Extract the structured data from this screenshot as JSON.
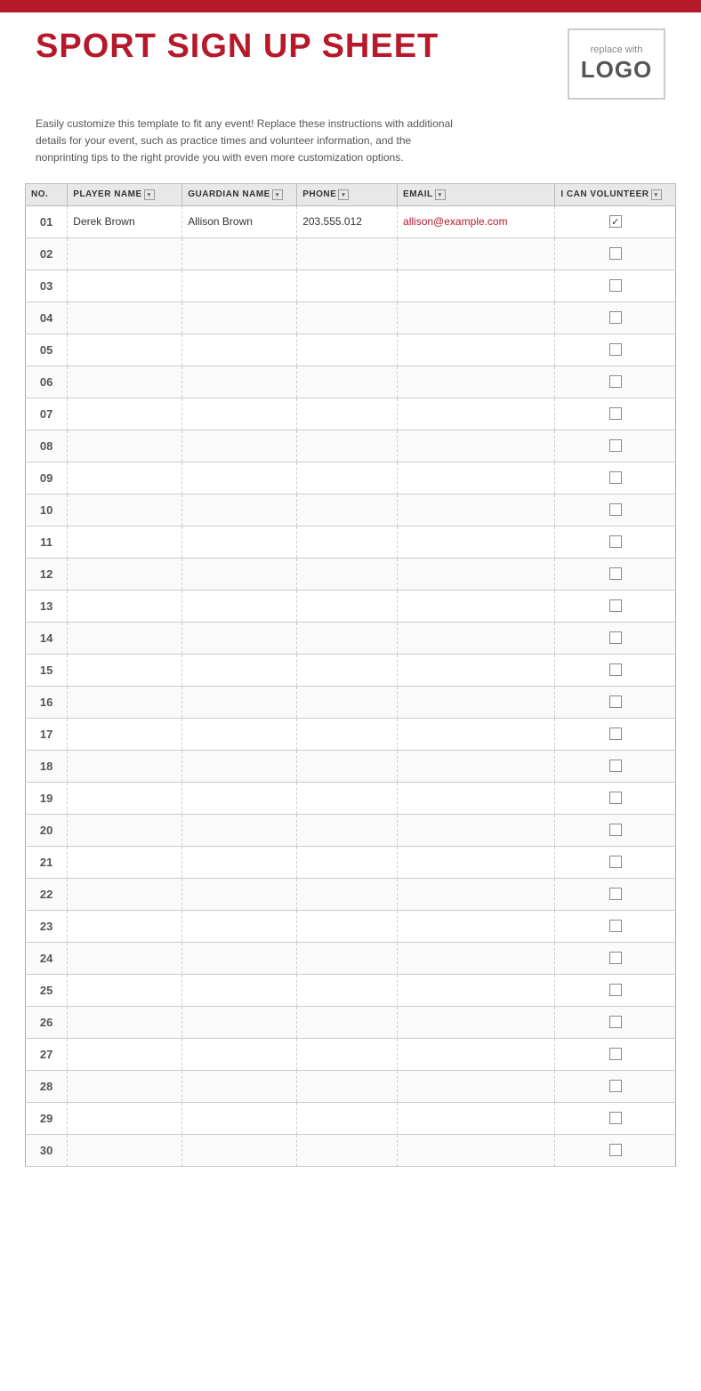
{
  "topBar": {},
  "header": {
    "title": "SPORT SIGN UP SHEET",
    "logo": {
      "replace_text": "replace with",
      "logo_text": "LOGO"
    }
  },
  "description": "Easily customize this template to fit any event! Replace these instructions with additional details for your event, such as practice times and volunteer information, and the nonprinting tips to the right provide you with even more customization options.",
  "table": {
    "columns": [
      {
        "label": "NO.",
        "has_dropdown": false
      },
      {
        "label": "PLAYER NAME",
        "has_dropdown": true
      },
      {
        "label": "GUARDIAN NAME",
        "has_dropdown": true
      },
      {
        "label": "PHONE",
        "has_dropdown": true
      },
      {
        "label": "EMAIL",
        "has_dropdown": true
      },
      {
        "label": "I CAN VOLUNTEER",
        "has_dropdown": true
      }
    ],
    "rows": [
      {
        "num": "01",
        "player": "Derek Brown",
        "guardian": "Allison Brown",
        "phone": "203.555.012",
        "email": "allison@example.com",
        "volunteer": true
      },
      {
        "num": "02",
        "player": "",
        "guardian": "",
        "phone": "",
        "email": "",
        "volunteer": false
      },
      {
        "num": "03",
        "player": "",
        "guardian": "",
        "phone": "",
        "email": "",
        "volunteer": false
      },
      {
        "num": "04",
        "player": "",
        "guardian": "",
        "phone": "",
        "email": "",
        "volunteer": false
      },
      {
        "num": "05",
        "player": "",
        "guardian": "",
        "phone": "",
        "email": "",
        "volunteer": false
      },
      {
        "num": "06",
        "player": "",
        "guardian": "",
        "phone": "",
        "email": "",
        "volunteer": false
      },
      {
        "num": "07",
        "player": "",
        "guardian": "",
        "phone": "",
        "email": "",
        "volunteer": false
      },
      {
        "num": "08",
        "player": "",
        "guardian": "",
        "phone": "",
        "email": "",
        "volunteer": false
      },
      {
        "num": "09",
        "player": "",
        "guardian": "",
        "phone": "",
        "email": "",
        "volunteer": false
      },
      {
        "num": "10",
        "player": "",
        "guardian": "",
        "phone": "",
        "email": "",
        "volunteer": false
      },
      {
        "num": "11",
        "player": "",
        "guardian": "",
        "phone": "",
        "email": "",
        "volunteer": false
      },
      {
        "num": "12",
        "player": "",
        "guardian": "",
        "phone": "",
        "email": "",
        "volunteer": false
      },
      {
        "num": "13",
        "player": "",
        "guardian": "",
        "phone": "",
        "email": "",
        "volunteer": false
      },
      {
        "num": "14",
        "player": "",
        "guardian": "",
        "phone": "",
        "email": "",
        "volunteer": false
      },
      {
        "num": "15",
        "player": "",
        "guardian": "",
        "phone": "",
        "email": "",
        "volunteer": false
      },
      {
        "num": "16",
        "player": "",
        "guardian": "",
        "phone": "",
        "email": "",
        "volunteer": false
      },
      {
        "num": "17",
        "player": "",
        "guardian": "",
        "phone": "",
        "email": "",
        "volunteer": false
      },
      {
        "num": "18",
        "player": "",
        "guardian": "",
        "phone": "",
        "email": "",
        "volunteer": false
      },
      {
        "num": "19",
        "player": "",
        "guardian": "",
        "phone": "",
        "email": "",
        "volunteer": false
      },
      {
        "num": "20",
        "player": "",
        "guardian": "",
        "phone": "",
        "email": "",
        "volunteer": false
      },
      {
        "num": "21",
        "player": "",
        "guardian": "",
        "phone": "",
        "email": "",
        "volunteer": false
      },
      {
        "num": "22",
        "player": "",
        "guardian": "",
        "phone": "",
        "email": "",
        "volunteer": false
      },
      {
        "num": "23",
        "player": "",
        "guardian": "",
        "phone": "",
        "email": "",
        "volunteer": false
      },
      {
        "num": "24",
        "player": "",
        "guardian": "",
        "phone": "",
        "email": "",
        "volunteer": false
      },
      {
        "num": "25",
        "player": "",
        "guardian": "",
        "phone": "",
        "email": "",
        "volunteer": false
      },
      {
        "num": "26",
        "player": "",
        "guardian": "",
        "phone": "",
        "email": "",
        "volunteer": false
      },
      {
        "num": "27",
        "player": "",
        "guardian": "",
        "phone": "",
        "email": "",
        "volunteer": false
      },
      {
        "num": "28",
        "player": "",
        "guardian": "",
        "phone": "",
        "email": "",
        "volunteer": false
      },
      {
        "num": "29",
        "player": "",
        "guardian": "",
        "phone": "",
        "email": "",
        "volunteer": false
      },
      {
        "num": "30",
        "player": "",
        "guardian": "",
        "phone": "",
        "email": "",
        "volunteer": false
      }
    ]
  },
  "colors": {
    "accent": "#b5192a",
    "header_bg": "#e8e8e8"
  }
}
